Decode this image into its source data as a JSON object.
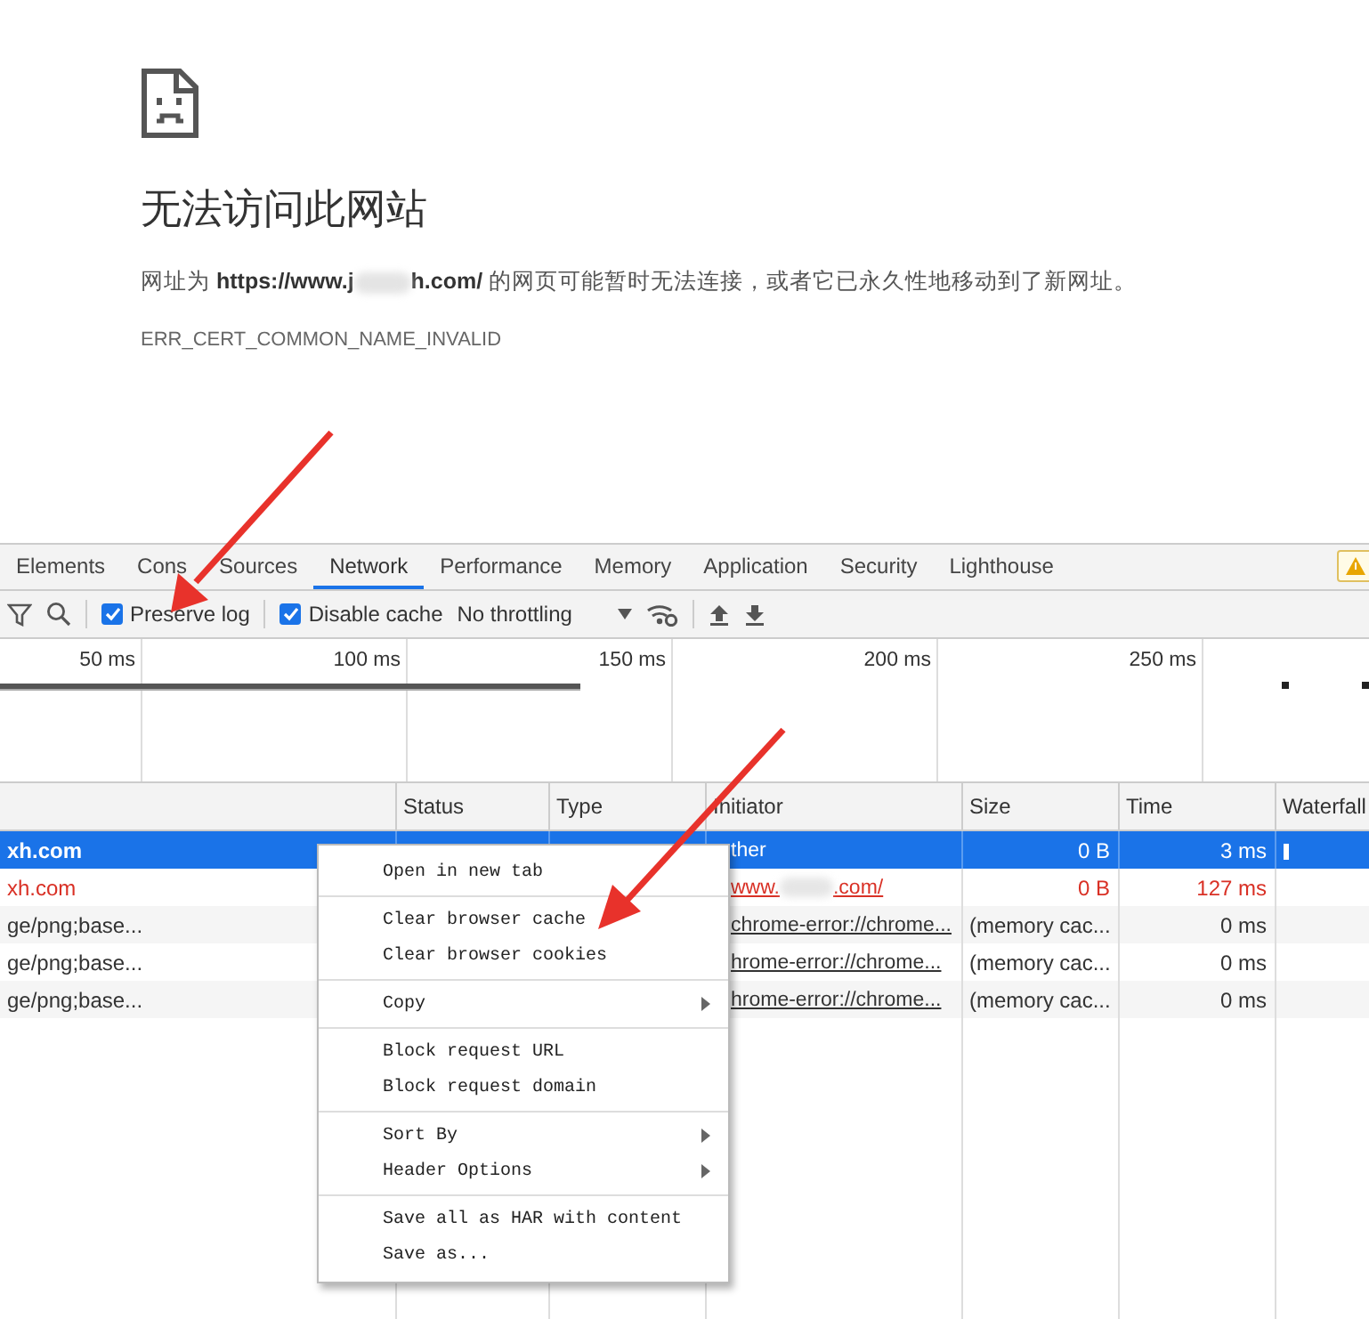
{
  "error_page": {
    "title": "无法访问此网站",
    "message": {
      "prefix": "网址为",
      "url_start": "https://www.j",
      "url_end": "h.com/",
      "suffix": "的网页可能暂时无法连接，或者它已永久性地移动到了新网址。"
    },
    "code": "ERR_CERT_COMMON_NAME_INVALID"
  },
  "devtools": {
    "tabs": [
      {
        "label": "Elements",
        "selected": false
      },
      {
        "label": "Cons",
        "selected": false
      },
      {
        "label": "Sources",
        "selected": false
      },
      {
        "label": "Network",
        "selected": true
      },
      {
        "label": "Performance",
        "selected": false
      },
      {
        "label": "Memory",
        "selected": false
      },
      {
        "label": "Application",
        "selected": false
      },
      {
        "label": "Security",
        "selected": false
      },
      {
        "label": "Lighthouse",
        "selected": false
      }
    ],
    "toolbar": {
      "preserve_log": {
        "label": "Preserve log",
        "checked": true
      },
      "disable_cache": {
        "label": "Disable cache",
        "checked": true
      },
      "throttling": "No throttling"
    },
    "timeline": {
      "ticks": [
        "50 ms",
        "100 ms",
        "150 ms",
        "200 ms",
        "250 ms"
      ]
    },
    "table": {
      "columns": [
        "Status",
        "Type",
        "Initiator",
        "Size",
        "Time",
        "Waterfall"
      ],
      "rows": [
        {
          "name": "xh.com",
          "initiator": [
            "ther"
          ],
          "size": "0 B",
          "time": "3 ms",
          "selected": true,
          "failed": false,
          "link": false
        },
        {
          "name": "xh.com",
          "initiator": [
            "www.",
            ".com/"
          ],
          "size": "0 B",
          "time": "127 ms",
          "selected": false,
          "failed": true,
          "link": true
        },
        {
          "name": "ge/png;base...",
          "initiator": [
            "chrome-error://chrome..."
          ],
          "size": "(memory cac...",
          "time": "0 ms",
          "selected": false,
          "failed": false,
          "link": true
        },
        {
          "name": "ge/png;base...",
          "initiator": [
            "hrome-error://chrome..."
          ],
          "size": "(memory cac...",
          "time": "0 ms",
          "selected": false,
          "failed": false,
          "link": true
        },
        {
          "name": "ge/png;base...",
          "initiator": [
            "hrome-error://chrome..."
          ],
          "size": "(memory cac...",
          "time": "0 ms",
          "selected": false,
          "failed": false,
          "link": true
        }
      ]
    }
  },
  "context_menu": {
    "groups": [
      [
        {
          "label": "Open in new tab",
          "submenu": false
        }
      ],
      [
        {
          "label": "Clear browser cache",
          "submenu": false
        },
        {
          "label": "Clear browser cookies",
          "submenu": false
        }
      ],
      [
        {
          "label": "Copy",
          "submenu": true
        }
      ],
      [
        {
          "label": "Block request URL",
          "submenu": false
        },
        {
          "label": "Block request domain",
          "submenu": false
        }
      ],
      [
        {
          "label": "Sort By",
          "submenu": true
        },
        {
          "label": "Header Options",
          "submenu": true
        }
      ],
      [
        {
          "label": "Save all as HAR with content",
          "submenu": false
        },
        {
          "label": "Save as...",
          "submenu": false
        }
      ]
    ]
  }
}
